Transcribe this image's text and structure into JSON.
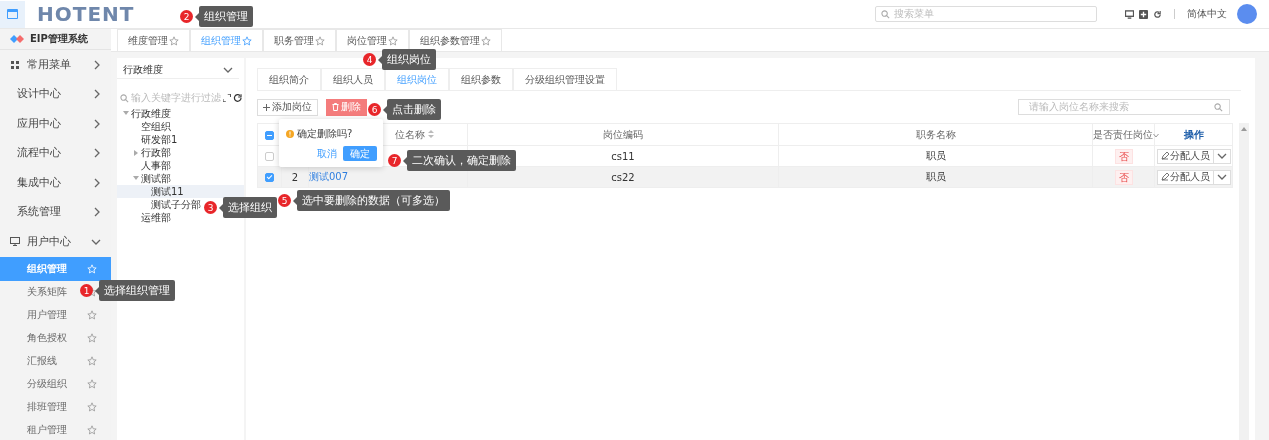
{
  "header": {
    "logo": "HOTENT",
    "search": {
      "placeholder": "搜索菜单"
    },
    "language": "简体中文"
  },
  "sidebar": {
    "title": "EIP管理系统",
    "items": [
      {
        "label": "常用菜单",
        "kind": "grid",
        "expanded": false
      },
      {
        "label": "设计中心",
        "kind": "plain",
        "expanded": false
      },
      {
        "label": "应用中心",
        "kind": "plain",
        "expanded": false
      },
      {
        "label": "流程中心",
        "kind": "plain",
        "expanded": false
      },
      {
        "label": "集成中心",
        "kind": "plain",
        "expanded": false
      },
      {
        "label": "系统管理",
        "kind": "plain",
        "expanded": false
      },
      {
        "label": "用户中心",
        "kind": "monitor",
        "expanded": true,
        "children": [
          {
            "label": "组织管理",
            "selected": true
          },
          {
            "label": "关系矩阵",
            "selected": false
          },
          {
            "label": "用户管理",
            "selected": false
          },
          {
            "label": "角色授权",
            "selected": false
          },
          {
            "label": "汇报线",
            "selected": false
          },
          {
            "label": "分级组织",
            "selected": false
          },
          {
            "label": "排班管理",
            "selected": false
          },
          {
            "label": "租户管理",
            "selected": false
          }
        ]
      }
    ]
  },
  "tabs": [
    {
      "label": "维度管理",
      "selected": false
    },
    {
      "label": "组织管理",
      "selected": true
    },
    {
      "label": "职务管理",
      "selected": false
    },
    {
      "label": "岗位管理",
      "selected": false
    },
    {
      "label": "组织参数管理",
      "selected": false
    }
  ],
  "org_tree": {
    "dimension": "行政维度",
    "filter": {
      "placeholder": "输入关键字进行过滤"
    },
    "nodes": [
      {
        "label": "行政维度",
        "expanded": true,
        "selected": false,
        "children": [
          {
            "label": "空组织",
            "selected": false
          },
          {
            "label": "研发部1",
            "selected": false
          },
          {
            "label": "行政部",
            "expanded": false,
            "selected": false
          },
          {
            "label": "人事部",
            "selected": false
          },
          {
            "label": "测试部",
            "expanded": true,
            "selected": false,
            "children": [
              {
                "label": "测试11",
                "selected": true
              },
              {
                "label": "测试子分部",
                "selected": false
              }
            ]
          },
          {
            "label": "运维部",
            "selected": false
          }
        ]
      }
    ]
  },
  "sub_tabs": [
    {
      "label": "组织简介",
      "selected": false
    },
    {
      "label": "组织人员",
      "selected": false
    },
    {
      "label": "组织岗位",
      "selected": true
    },
    {
      "label": "组织参数",
      "selected": false
    },
    {
      "label": "分级组织管理设置",
      "selected": false
    }
  ],
  "toolbar": {
    "add_button": "添加岗位",
    "delete_button": "删除",
    "search": {
      "placeholder": "请输入岗位名称来搜索"
    }
  },
  "table": {
    "indeterminate": true,
    "columns": [
      {
        "label": "位名称",
        "kind": "sortable"
      },
      {
        "label": "岗位编码",
        "kind": "plain"
      },
      {
        "label": "职务名称",
        "kind": "plain"
      },
      {
        "label": "是否责任岗位",
        "kind": "filter"
      },
      {
        "label": "操作",
        "kind": "action"
      }
    ],
    "rows": [
      {
        "checked": false,
        "selected": false,
        "code": "cs11",
        "duty": "职员",
        "responsible": "否",
        "action": "分配人员"
      },
      {
        "checked": true,
        "selected": true,
        "index": "2",
        "name": "测试007",
        "code": "cs22",
        "duty": "职员",
        "responsible": "否",
        "action": "分配人员"
      }
    ]
  },
  "popover": {
    "message": "确定删除吗?",
    "cancel": "取消",
    "confirm": "确定"
  },
  "callouts": [
    {
      "number": "2",
      "text": "组织管理"
    },
    {
      "number": "4",
      "text": "组织岗位"
    },
    {
      "number": "6",
      "text": "点击删除"
    },
    {
      "number": "7",
      "text": "二次确认，确定删除"
    },
    {
      "number": "5",
      "text": "选中要删除的数据（可多选）"
    },
    {
      "number": "3",
      "text": "选择组织"
    },
    {
      "number": "1",
      "text": "选择组织管理"
    }
  ]
}
